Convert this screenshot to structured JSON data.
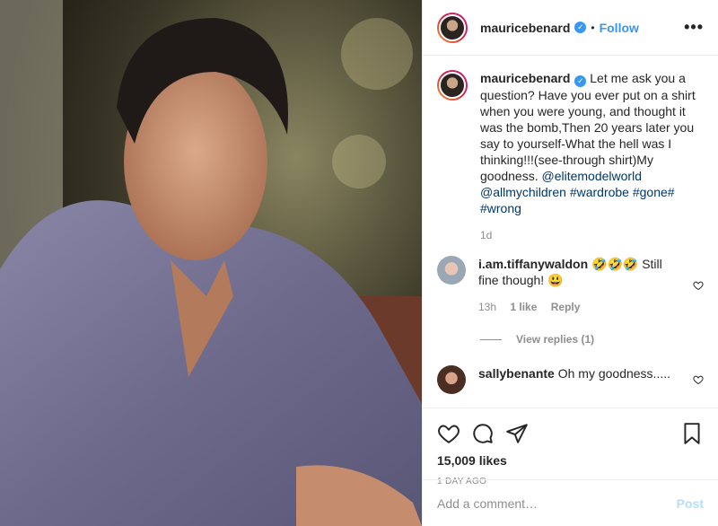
{
  "post": {
    "username": "mauricebenard",
    "follow_label": "Follow",
    "separator": "•",
    "verified_symbol": "✓",
    "more_symbol": "•••",
    "caption": {
      "username": "mauricebenard",
      "text": "Let me ask you a question? Have you ever put on a shirt when you were young, and thought it was the bomb,Then 20 years later you say to yourself-What the hell was I thinking!!!(see-through shirt)My goodness. ",
      "mention1": "@elitemodelworld",
      "mention2": "@allmychildren",
      "tag1": "#wardrobe",
      "tag2": "#gone",
      "tag2_suffix": "#",
      "tag3": "#wrong",
      "time": "1d"
    },
    "comments": [
      {
        "username": "i.am.tiffanywaldon",
        "text": "🤣🤣🤣 Still fine though! 😃",
        "time": "13h",
        "likes": "1 like",
        "reply_label": "Reply",
        "view_replies": "View replies (1)"
      },
      {
        "username": "sallybenante",
        "text": "Oh my goodness....."
      }
    ],
    "likes": "15,009 likes",
    "posted_ago": "1 DAY AGO",
    "add_comment_placeholder": "Add a comment…",
    "post_label": "Post"
  },
  "colors": {
    "accent": "#3897f0",
    "link": "#00376b",
    "muted": "#8e8e8e",
    "post_disabled": "#b2dffc"
  },
  "icons": [
    "verified-icon",
    "more-options-icon",
    "heart-icon",
    "comment-icon",
    "share-icon",
    "bookmark-icon"
  ]
}
